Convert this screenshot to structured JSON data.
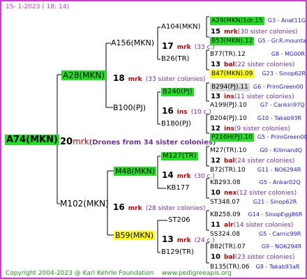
{
  "header": {
    "date": "15-   1-2023 (  18:  14)"
  },
  "root": {
    "name": "A74(MKN)",
    "count": "20",
    "abbr": "mrk",
    "note": "(Drones from 34 sister colonies)"
  },
  "gen1": [
    {
      "name": "A28(MKN)",
      "count": "18",
      "abbr": "mrk",
      "note": "(33 sister colonies)"
    },
    {
      "name": "M102(MKN)",
      "count": "16",
      "abbr": "mrk",
      "note": "(28 sister colonies)"
    }
  ],
  "gen2": [
    {
      "name": "A156(MKN)",
      "count": "17",
      "abbr": "mrk",
      "note": "(33 c.)"
    },
    {
      "name": "B100(PJ)",
      "count": "16",
      "abbr": "ins",
      "note": "(10 c.)"
    },
    {
      "name": "M48(MKN)",
      "count": "14",
      "abbr": "mrk",
      "note": "(30 c.)"
    },
    {
      "name": "B59(MKN)",
      "count": "13",
      "abbr": "mrk",
      "note": "(24 c.)"
    }
  ],
  "gen3": [
    {
      "name": "A104(MKN)",
      "count": "15",
      "abbr": "mrk",
      "note": "(30 sister colonies)"
    },
    {
      "name": "B26(TR)",
      "count": "13",
      "abbr": "bal",
      "note": "(22 sister colonies)"
    },
    {
      "name": "B240(PJ)",
      "count": "13",
      "abbr": "ins",
      "note": "(11 sister colonies)"
    },
    {
      "name": "B180(PJ)",
      "count": "12",
      "abbr": "ins",
      "note": "(9 sister colonies)"
    },
    {
      "name": "M127(TR)",
      "count": "12",
      "abbr": "bal",
      "note": "(24 sister colonies)"
    },
    {
      "name": "KB177",
      "count": "10",
      "abbr": "nex",
      "note": "(12 sister colonies)"
    },
    {
      "name": "ST206",
      "count": "11",
      "abbr": "alr",
      "note": "(14 sister colonies)"
    },
    {
      "name": "B129(TR)",
      "count": "10",
      "abbr": "bal",
      "note": "(23 sister colonies)"
    }
  ],
  "gen4": [
    {
      "name": "A29(MKN)1dr.15",
      "gpn": "G3",
      "gname": "Anat11G"
    },
    {
      "name": "B53(MKN).12",
      "gpn": "G5",
      "gname": "Gr.R.mounta"
    },
    {
      "name": "B77(TR).12",
      "gpn": "G8",
      "gname": "MG00R"
    },
    {
      "name": "B47(MKN).09",
      "gpn": "G23",
      "gname": "Sinop62R"
    },
    {
      "name": "B294(PJ).11",
      "gpn": "G6",
      "gname": "PrimGreen00"
    },
    {
      "name": "A199(PJ).10",
      "gpn": "G7",
      "gname": "Cankiri97Q"
    },
    {
      "name": "B204(PJ).10",
      "gpn": "G10",
      "gname": "Takab93R"
    },
    {
      "name": "P216H(PJ).10",
      "gpn": "G5",
      "gname": "PrimGreen00"
    },
    {
      "name": "M27(TR).10",
      "gpn": "G0",
      "gname": "KilimandQ"
    },
    {
      "name": "B72(TR).10",
      "gpn": "G11",
      "gname": "NO6294R"
    },
    {
      "name": "KB293.08",
      "gpn": "G5",
      "gname": "Ankar02Q"
    },
    {
      "name": "ST348.07",
      "gpn": "G21",
      "gname": "Sinop62R"
    },
    {
      "name": "KB258.09",
      "gpn": "G14",
      "gname": "SinopEgg86R"
    },
    {
      "name": "SS324.08",
      "gpn": "G5",
      "gname": "Carnic99R"
    },
    {
      "name": "B82(TR).07",
      "gpn": "G9",
      "gname": "NO6294R"
    },
    {
      "name": "B135(TR).06",
      "gpn": "G8",
      "gname": "Takab93aR"
    }
  ],
  "footer": {
    "copyright": "Copyright 2004-2023 @ Karl Kehrle Foundation",
    "site": "www.pedigreeapis.org"
  },
  "colors": {
    "frame": "#d03ad0",
    "green_box": "#22e022",
    "yellow_box": "#ffff00",
    "grey_box": "#d8d8d8",
    "abbr": "#c00000",
    "sister": "#7030a0",
    "gpn": "#1a1aff",
    "footer": "#2a8f2a"
  }
}
